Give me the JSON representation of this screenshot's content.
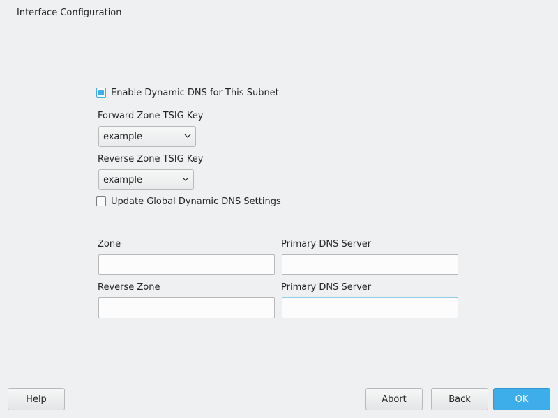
{
  "window": {
    "title": "Interface Configuration"
  },
  "ddns": {
    "enable_label": "Enable Dynamic DNS for This Subnet",
    "enable_checked": true,
    "forward_key_label": "Forward Zone TSIG Key",
    "forward_key_value": "example",
    "reverse_key_label": "Reverse Zone TSIG Key",
    "reverse_key_value": "example",
    "update_global_label": "Update Global Dynamic DNS Settings",
    "update_global_checked": false
  },
  "zones": {
    "zone_label": "Zone",
    "zone_value": "",
    "zone_primary_label": "Primary DNS Server",
    "zone_primary_value": "",
    "reverse_zone_label": "Reverse Zone",
    "reverse_zone_value": "",
    "reverse_primary_label": "Primary DNS Server",
    "reverse_primary_value": ""
  },
  "buttons": {
    "help": "Help",
    "abort": "Abort",
    "back": "Back",
    "ok": "OK"
  },
  "colors": {
    "accent": "#3daee9",
    "background": "#eff0f1"
  },
  "icons": {
    "combo_arrow": "chevron-down-icon"
  }
}
